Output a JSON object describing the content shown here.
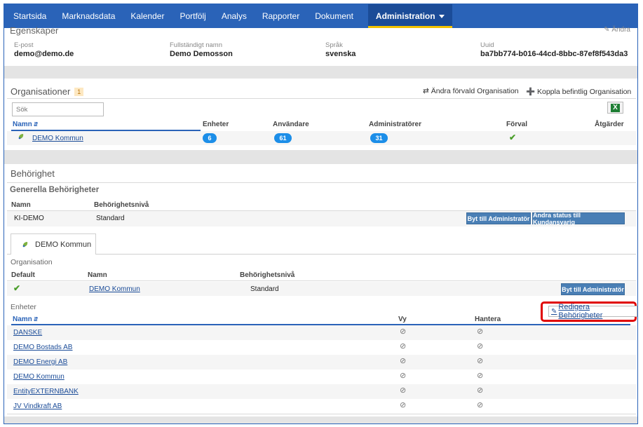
{
  "nav": {
    "items": [
      "Startsida",
      "Marknadsdata",
      "Kalender",
      "Portfölj",
      "Analys",
      "Rapporter",
      "Dokument"
    ],
    "active": "Administration"
  },
  "properties": {
    "heading": "Egenskaper",
    "edit": "Ändra",
    "email_label": "E-post",
    "email": "demo@demo.de",
    "name_label": "Fullständigt namn",
    "name": "Demo Demosson",
    "lang_label": "Språk",
    "lang": "svenska",
    "uuid_label": "Uuid",
    "uuid": "ba7bb774-b016-44cd-8bbc-87ef8f543da3"
  },
  "orgs": {
    "title": "Organisationer",
    "count": "1",
    "change_default": "Ändra förvald Organisation",
    "connect": "Koppla befintlig Organisation",
    "search_placeholder": "Sök",
    "excel": "X",
    "cols": {
      "name": "Namn",
      "units": "Enheter",
      "users": "Användare",
      "admins": "Administratörer",
      "default": "Förval",
      "actions": "Åtgärder"
    },
    "row": {
      "name": "DEMO Kommun",
      "units": "6",
      "users": "61",
      "admins": "31"
    }
  },
  "perm": {
    "title": "Behörighet",
    "general_title": "Generella Behörigheter",
    "col_name": "Namn",
    "col_level": "Behörighetsnivå",
    "row_name": "KI-DEMO",
    "row_level": "Standard",
    "btn_admin": "Byt till Administratör",
    "btn_status": "Ändra status till Kundansvarig",
    "tab": "DEMO Kommun",
    "org_title": "Organisation",
    "org_col_default": "Default",
    "org_col_name": "Namn",
    "org_col_level": "Behörighetsnivå",
    "org_row_name": "DEMO Kommun",
    "org_row_level": "Standard",
    "org_btn_admin": "Byt till Administratör"
  },
  "units": {
    "title": "Enheter",
    "edit": "Redigera Behörigheter",
    "col_name": "Namn",
    "col_view": "Vy",
    "col_manage": "Hantera",
    "rows": [
      "DANSKE",
      "DEMO Bostads AB",
      "DEMO Energi AB",
      "DEMO Kommun",
      "EntityEXTERNBANK",
      "JV Vindkraft AB"
    ]
  },
  "colors": {
    "nav": "#2a63b8",
    "nav_active": "#1b4c98",
    "nav_accent": "#f2c200",
    "pill": "#1c8ee8",
    "button": "#4a7fb5",
    "check": "#4a9e2a",
    "highlight": "#e00000"
  },
  "icons": {
    "edit": "pencil-square-icon",
    "swap": "swap-arrows-icon",
    "plus": "plus-circle-icon",
    "excel": "excel-icon",
    "leaf": "org-leaf-icon",
    "check": "checkmark-icon",
    "deny": "not-allowed-icon"
  }
}
